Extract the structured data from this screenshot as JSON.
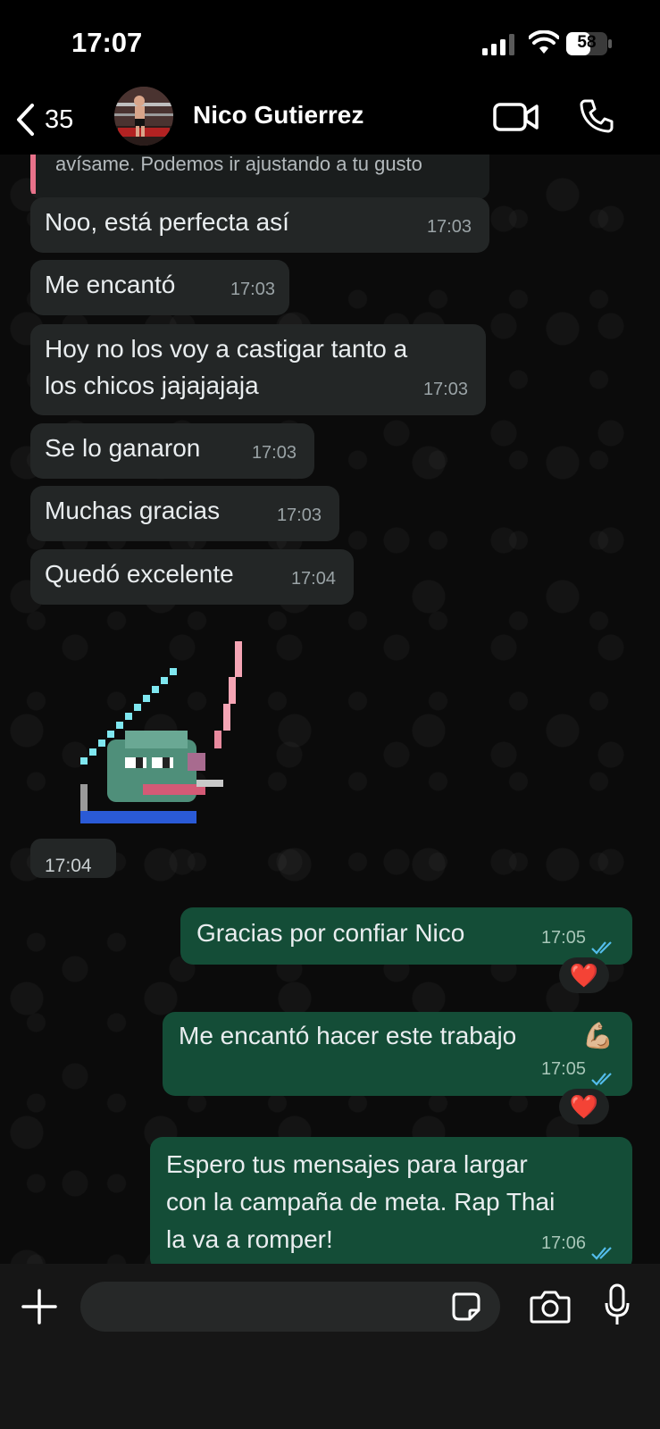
{
  "status_bar": {
    "time": "17:07",
    "battery": "58"
  },
  "header": {
    "back_count": "35",
    "contact_name": "Nico Gutierrez"
  },
  "quoted_reply": {
    "text": "avísame. Podemos ir ajustando a tu gusto"
  },
  "messages": [
    {
      "direction": "incoming",
      "text": "Noo, está perfecta así",
      "time": "17:03"
    },
    {
      "direction": "incoming",
      "text": "Me encantó",
      "time": "17:03"
    },
    {
      "direction": "incoming",
      "text": "Hoy no los voy a castigar tanto a los chicos jajajajaja",
      "line1": "Hoy no los voy a castigar tanto a",
      "line2": "los chicos jajajajaja",
      "time": "17:03"
    },
    {
      "direction": "incoming",
      "text": "Se lo ganaron",
      "time": "17:03"
    },
    {
      "direction": "incoming",
      "text": "Muchas gracias",
      "time": "17:03"
    },
    {
      "direction": "incoming",
      "text": "Quedó excelente",
      "time": "17:04"
    },
    {
      "direction": "incoming",
      "type": "sticker",
      "time": "17:04"
    },
    {
      "direction": "outgoing",
      "text": "Gracias por confiar Nico",
      "time": "17:05",
      "status": "read",
      "reaction": "❤️"
    },
    {
      "direction": "outgoing",
      "text": "Me encantó hacer este trabajo",
      "emoji": "💪🏼",
      "time": "17:05",
      "status": "read",
      "reaction": "❤️"
    },
    {
      "direction": "outgoing",
      "text": "Espero tus mensajes para largar con la campaña de meta. Rap Thai la va a romper!",
      "line1": "Espero tus mensajes para largar",
      "line2": "con la campaña de meta. Rap Thai",
      "line3": "la va a romper!",
      "time": "17:06",
      "status": "read"
    }
  ],
  "input_bar": {
    "placeholder": ""
  },
  "colors": {
    "incoming_bubble": "#232626",
    "outgoing_bubble": "#144d37",
    "read_ticks": "#53bdeb",
    "background": "#0b0b0b"
  }
}
